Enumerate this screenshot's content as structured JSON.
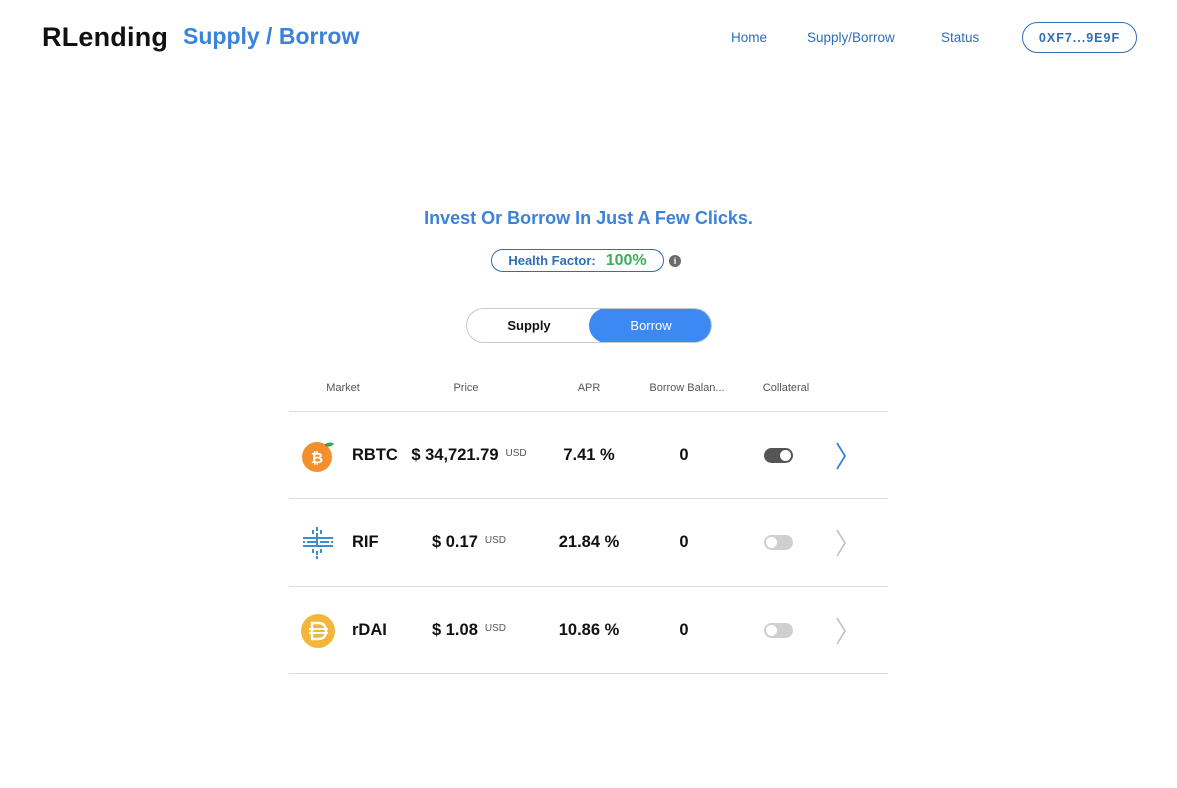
{
  "header": {
    "brand": "RLending",
    "page_title": "Supply / Borrow",
    "nav": [
      "Home",
      "Supply/Borrow",
      "Status"
    ],
    "wallet": "0XF7...9E9F"
  },
  "hero": {
    "title": "Invest Or Borrow In Just A Few Clicks.",
    "health_label": "Health Factor:",
    "health_value": "100%",
    "info_icon": "i"
  },
  "tabs": {
    "supply": "Supply",
    "borrow": "Borrow",
    "active": "Borrow"
  },
  "table": {
    "headers": [
      "Market",
      "Price",
      "APR",
      "Borrow Balan...",
      "Collateral"
    ],
    "rows": [
      {
        "icon": "rbtc-coin-icon",
        "name": "RBTC",
        "price": "$ 34,721.79",
        "unit": "USD",
        "apr": "7.41 %",
        "balance": "0",
        "collateral": true
      },
      {
        "icon": "rif-coin-icon",
        "name": "RIF",
        "price": "$ 0.17",
        "unit": "USD",
        "apr": "21.84 %",
        "balance": "0",
        "collateral": false
      },
      {
        "icon": "rdai-coin-icon",
        "name": "rDAI",
        "price": "$ 1.08",
        "unit": "USD",
        "apr": "10.86 %",
        "balance": "0",
        "collateral": false
      }
    ]
  },
  "colors": {
    "accent": "#3b82d9",
    "link": "#2f6db7",
    "active_tab": "#3d89f3",
    "health_good": "#3fae5b",
    "rbtc": "#f2902e",
    "rif": "#3a8fd0",
    "rdai": "#f2b73a"
  }
}
